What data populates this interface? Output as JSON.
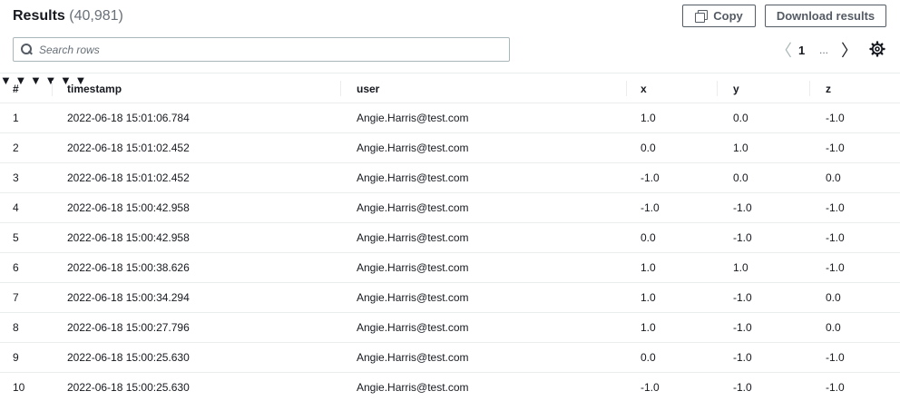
{
  "header": {
    "title": "Results",
    "count": "(40,981)",
    "copy_label": "Copy",
    "download_label": "Download results"
  },
  "search": {
    "placeholder": "Search rows",
    "value": ""
  },
  "pagination": {
    "current_page": "1",
    "ellipsis": "...",
    "prev_symbol": "〈",
    "next_symbol": "〉"
  },
  "icons": {
    "settings": "gear-icon",
    "copy": "copy-icon",
    "search": "search-icon"
  },
  "table": {
    "columns": [
      "#",
      "timestamp",
      "user",
      "x",
      "y",
      "z"
    ],
    "rows": [
      [
        "1",
        "2022-06-18 15:01:06.784",
        "Angie.Harris@test.com",
        "1.0",
        "0.0",
        "-1.0"
      ],
      [
        "2",
        "2022-06-18 15:01:02.452",
        "Angie.Harris@test.com",
        "0.0",
        "1.0",
        "-1.0"
      ],
      [
        "3",
        "2022-06-18 15:01:02.452",
        "Angie.Harris@test.com",
        "-1.0",
        "0.0",
        "0.0"
      ],
      [
        "4",
        "2022-06-18 15:00:42.958",
        "Angie.Harris@test.com",
        "-1.0",
        "-1.0",
        "-1.0"
      ],
      [
        "5",
        "2022-06-18 15:00:42.958",
        "Angie.Harris@test.com",
        "0.0",
        "-1.0",
        "-1.0"
      ],
      [
        "6",
        "2022-06-18 15:00:38.626",
        "Angie.Harris@test.com",
        "1.0",
        "1.0",
        "-1.0"
      ],
      [
        "7",
        "2022-06-18 15:00:34.294",
        "Angie.Harris@test.com",
        "1.0",
        "-1.0",
        "0.0"
      ],
      [
        "8",
        "2022-06-18 15:00:27.796",
        "Angie.Harris@test.com",
        "1.0",
        "-1.0",
        "0.0"
      ],
      [
        "9",
        "2022-06-18 15:00:25.630",
        "Angie.Harris@test.com",
        "0.0",
        "-1.0",
        "-1.0"
      ],
      [
        "10",
        "2022-06-18 15:00:25.630",
        "Angie.Harris@test.com",
        "-1.0",
        "-1.0",
        "-1.0"
      ]
    ]
  },
  "colors": {
    "text": "#16191f",
    "muted": "#687078",
    "border": "#eaeded",
    "button_border": "#545b64"
  }
}
